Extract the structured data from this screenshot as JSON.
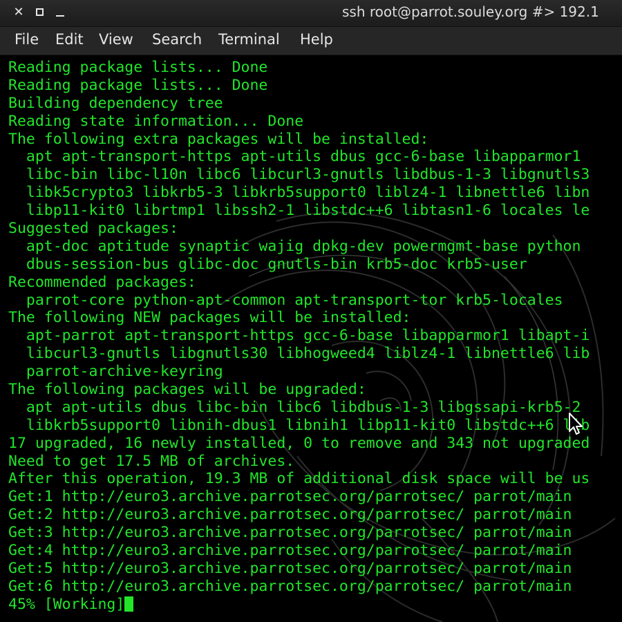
{
  "window": {
    "title": "ssh root@parrot.souley.org #> 192.1",
    "controls": [
      "close-icon",
      "maximize-icon",
      "minimize-icon"
    ]
  },
  "menu": [
    "File",
    "Edit",
    "View",
    "Search",
    "Terminal",
    "Help"
  ],
  "terminal": {
    "text_color": "#22e52a",
    "background": "#000000",
    "lines": [
      "Reading package lists... Done",
      "Reading package lists... Done",
      "Building dependency tree",
      "Reading state information... Done",
      "The following extra packages will be installed:",
      "  apt apt-transport-https apt-utils dbus gcc-6-base libapparmor1",
      "  libc-bin libc-l10n libc6 libcurl3-gnutls libdbus-1-3 libgnutls3",
      "  libk5crypto3 libkrb5-3 libkrb5support0 liblz4-1 libnettle6 libn",
      "  libp11-kit0 librtmp1 libssh2-1 libstdc++6 libtasn1-6 locales le",
      "Suggested packages:",
      "  apt-doc aptitude synaptic wajig dpkg-dev powermgmt-base python",
      "  dbus-session-bus glibc-doc gnutls-bin krb5-doc krb5-user",
      "Recommended packages:",
      "  parrot-core python-apt-common apt-transport-tor krb5-locales",
      "The following NEW packages will be installed:",
      "  apt-parrot apt-transport-https gcc-6-base libapparmor1 libapt-i",
      "  libcurl3-gnutls libgnutls30 libhogweed4 liblz4-1 libnettle6 lib",
      "  parrot-archive-keyring",
      "The following packages will be upgraded:",
      "  apt apt-utils dbus libc-bin libc6 libdbus-1-3 libgssapi-krb5-2",
      "  libkrb5support0 libnih-dbus1 libnih1 libp11-kit0 libstdc++6 lib",
      "17 upgraded, 16 newly installed, 0 to remove and 343 not upgraded",
      "Need to get 17.5 MB of archives.",
      "After this operation, 19.3 MB of additional disk space will be us",
      "Get:1 http://euro3.archive.parrotsec.org/parrotsec/ parrot/main ",
      "Get:2 http://euro3.archive.parrotsec.org/parrotsec/ parrot/main ",
      "Get:3 http://euro3.archive.parrotsec.org/parrotsec/ parrot/main ",
      "Get:4 http://euro3.archive.parrotsec.org/parrotsec/ parrot/main ",
      "Get:5 http://euro3.archive.parrotsec.org/parrotsec/ parrot/main ",
      "Get:6 http://euro3.archive.parrotsec.org/parrotsec/ parrot/main "
    ],
    "prompt_line": "45% [Working]"
  },
  "pointer": "mouse-pointer-icon"
}
